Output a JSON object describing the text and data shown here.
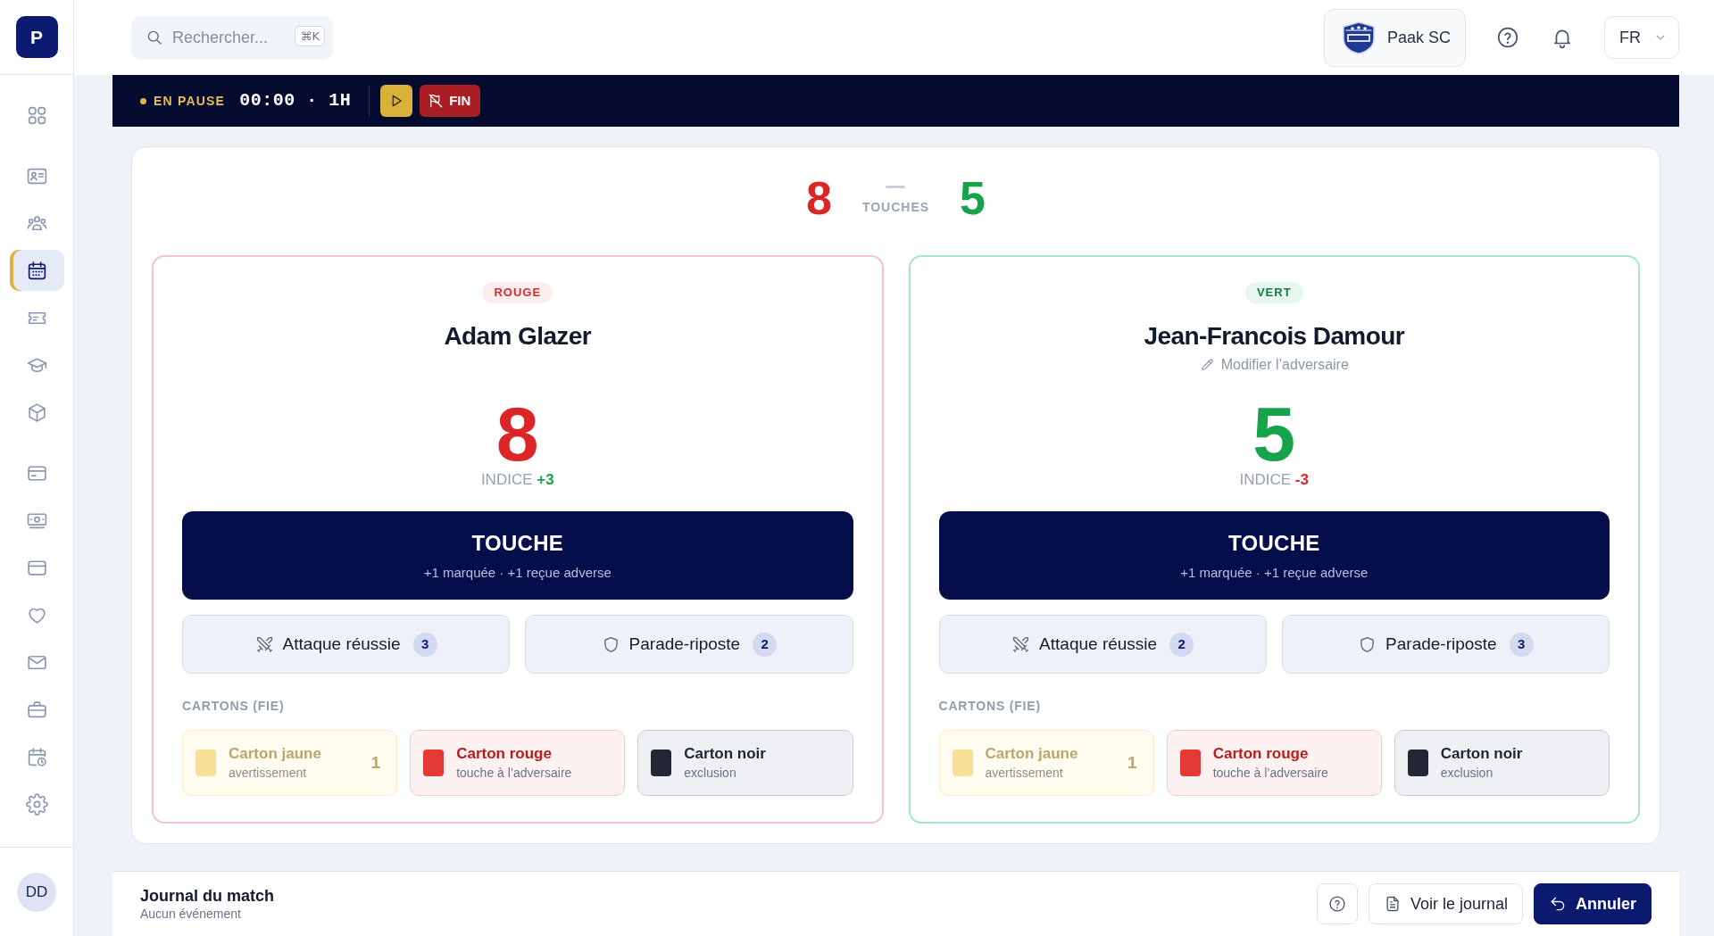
{
  "brand": {
    "letter": "P"
  },
  "sidebar": {
    "groups": [
      {
        "items": [
          {
            "selected": false
          }
        ]
      },
      {
        "items": [
          {
            "selected": false
          },
          {
            "selected": false
          },
          {
            "selected": true
          },
          {
            "selected": false
          },
          {
            "selected": false
          },
          {
            "selected": false
          }
        ]
      },
      {
        "items": [
          {
            "selected": false
          },
          {
            "selected": false
          },
          {
            "selected": false
          },
          {
            "selected": false
          },
          {
            "selected": false
          },
          {
            "selected": false
          },
          {
            "selected": false
          },
          {
            "selected": false
          }
        ]
      }
    ],
    "user": {
      "initials": "DD"
    }
  },
  "topbar": {
    "search": {
      "placeholder": "Rechercher...",
      "shortcut": "⌘K"
    },
    "club": {
      "name": "Paak SC"
    },
    "language": {
      "value": "FR"
    }
  },
  "match_bar": {
    "status": "EN PAUSE",
    "clock": "00:00 · 1H",
    "end_button": {
      "label": "FIN"
    }
  },
  "score_header": {
    "label": "TOUCHES",
    "scores": [
      {
        "value": "8",
        "kind": "red"
      },
      {
        "value": "5",
        "kind": "green"
      }
    ]
  },
  "fencers": [
    {
      "kind": "red",
      "side_label": "ROUGE",
      "name": "Adam Glazer",
      "score": "8",
      "index": {
        "text": "INDICE **+3**",
        "positive": true
      },
      "touch_button": {
        "label": "TOUCHE",
        "subtitle": "+1 marquée · +1 reçue adverse"
      },
      "actions": [
        {
          "kind": "attack",
          "label": "Attaque réussie",
          "count": "3"
        },
        {
          "kind": "parry",
          "label": "Parade-riposte",
          "count": "2"
        }
      ],
      "cards_label": "CARTONS (FIE)",
      "cards": [
        {
          "kind": "yellow",
          "title": "Carton jaune",
          "subtitle": "avertissement",
          "count": "1",
          "disabled": true
        },
        {
          "kind": "red",
          "title": "Carton rouge",
          "subtitle": "touche à l’adversaire",
          "disabled": false
        },
        {
          "kind": "black",
          "title": "Carton noir",
          "subtitle": "exclusion",
          "disabled": false
        }
      ]
    },
    {
      "kind": "green",
      "side_label": "VERT",
      "name": "Jean-Francois Damour",
      "edit_link": "Modifier l’adversaire",
      "score": "5",
      "index": {
        "text": "INDICE **-3**",
        "positive": false
      },
      "touch_button": {
        "label": "TOUCHE",
        "subtitle": "+1 marquée · +1 reçue adverse"
      },
      "actions": [
        {
          "kind": "attack",
          "label": "Attaque réussie",
          "count": "2"
        },
        {
          "kind": "parry",
          "label": "Parade-riposte",
          "count": "3"
        }
      ],
      "cards_label": "CARTONS (FIE)",
      "cards": [
        {
          "kind": "yellow",
          "title": "Carton jaune",
          "subtitle": "avertissement",
          "count": "1",
          "disabled": true
        },
        {
          "kind": "red",
          "title": "Carton rouge",
          "subtitle": "touche à l’adversaire",
          "disabled": false
        },
        {
          "kind": "black",
          "title": "Carton noir",
          "subtitle": "exclusion",
          "disabled": false
        }
      ]
    }
  ],
  "footer": {
    "title": "Journal du match",
    "subtitle": "Aucun événement",
    "buttons": [
      {
        "kind": "help"
      },
      {
        "kind": "document",
        "label": "Voir le journal"
      },
      {
        "kind": "undo",
        "label": "Annuler"
      }
    ]
  }
}
